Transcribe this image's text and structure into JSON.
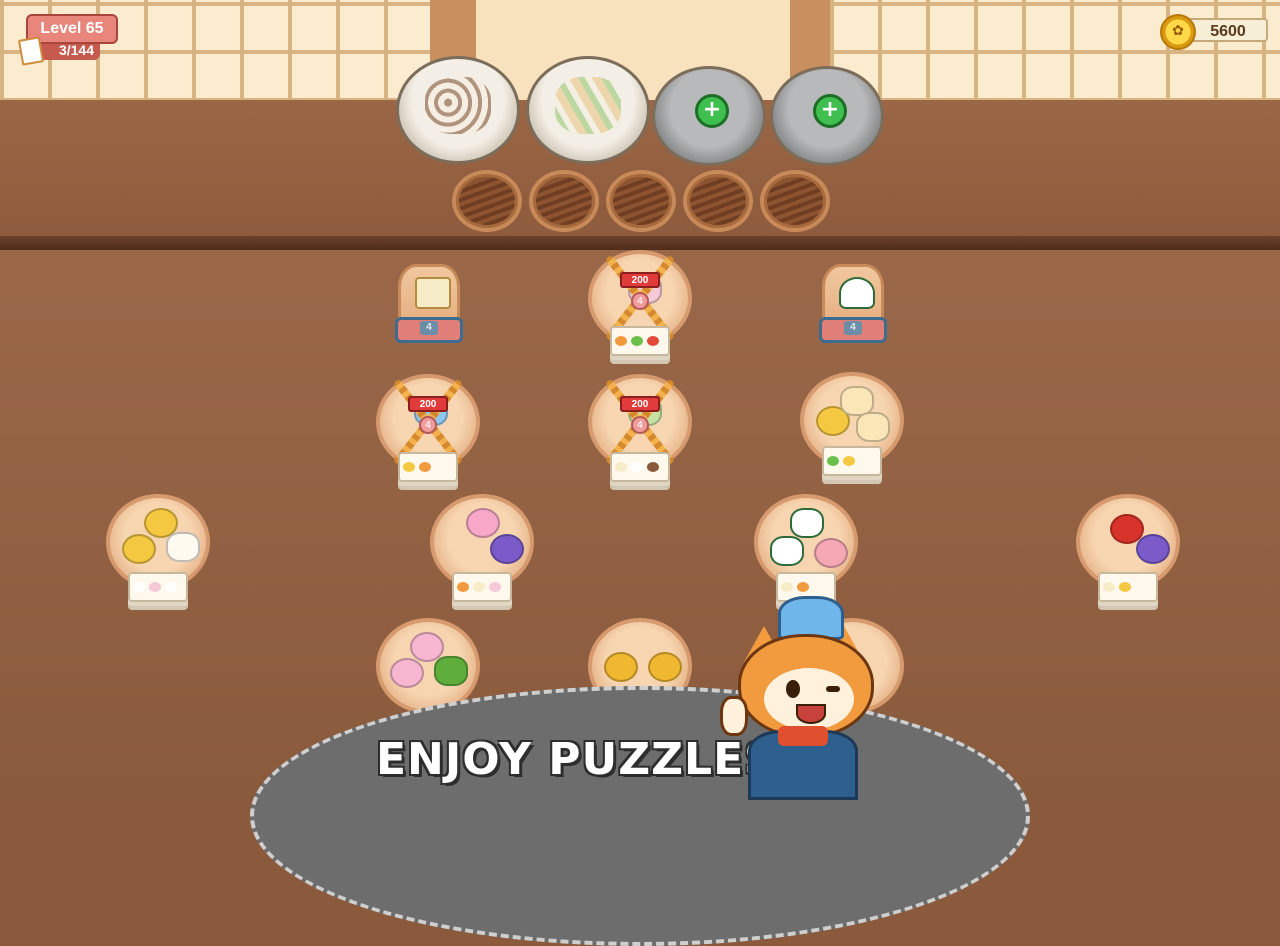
{
  "hud": {
    "level_label": "Level 65",
    "progress": "3/144",
    "coins": "5600",
    "coin_icon": "paw-coin-icon"
  },
  "serving": {
    "plates": [
      {
        "state": "filled",
        "food": "sushi rolls"
      },
      {
        "state": "filled",
        "food": "cucumber sandwiches"
      },
      {
        "state": "empty",
        "icon": "plus-icon"
      },
      {
        "state": "empty",
        "icon": "plus-icon"
      }
    ],
    "slots_count": 5
  },
  "locks": [
    {
      "cost": "200",
      "count": "4"
    },
    {
      "cost": "200",
      "count": "4"
    },
    {
      "cost": "200",
      "count": "4"
    }
  ],
  "small_steamers": [
    {
      "count": "4"
    },
    {
      "count": "4"
    }
  ],
  "banner": {
    "text": "ENJOY PUZZLES!"
  },
  "colors": {
    "accent_green": "#3fbf4f",
    "lock_red": "#e23b3b",
    "coin_gold": "#ffd84a"
  }
}
